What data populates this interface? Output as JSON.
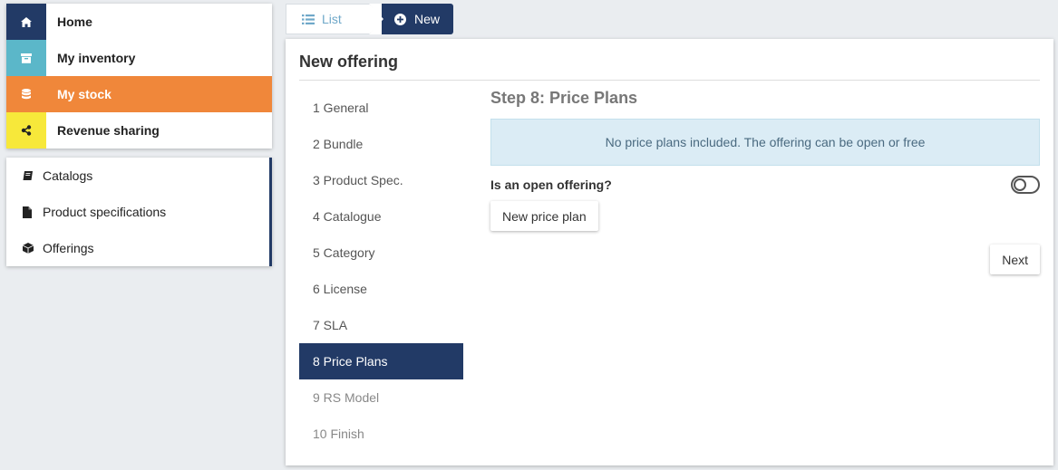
{
  "main_nav": [
    {
      "label": "Home",
      "icon": "home-icon",
      "color": "#223a66"
    },
    {
      "label": "My inventory",
      "icon": "archive-icon",
      "color": "#5bb7c9"
    },
    {
      "label": "My stock",
      "icon": "database-icon",
      "color": "#f0873a",
      "active": true
    },
    {
      "label": "Revenue sharing",
      "icon": "share-icon",
      "color": "#f7e83a"
    }
  ],
  "sub_nav": [
    {
      "label": "Catalogs",
      "icon": "book-icon"
    },
    {
      "label": "Product specifications",
      "icon": "file-icon"
    },
    {
      "label": "Offerings",
      "icon": "cube-icon",
      "active": true
    }
  ],
  "breadcrumb": {
    "list_label": "List",
    "new_label": "New"
  },
  "panel": {
    "title": "New offering",
    "steps": [
      {
        "label": "1 General"
      },
      {
        "label": "2 Bundle"
      },
      {
        "label": "3 Product Spec."
      },
      {
        "label": "4 Catalogue"
      },
      {
        "label": "5 Category"
      },
      {
        "label": "6 License"
      },
      {
        "label": "7 SLA"
      },
      {
        "label": "8 Price Plans",
        "active": true
      },
      {
        "label": "9 RS Model",
        "disabled": true
      },
      {
        "label": "10 Finish",
        "disabled": true
      }
    ],
    "step_title": "Step 8: Price Plans",
    "info_message": "No price plans included. The offering can be open or free",
    "open_offering_label": "Is an open offering?",
    "open_offering_value": false,
    "new_price_plan_label": "New price plan",
    "next_label": "Next"
  },
  "colors": {
    "primary": "#223a66",
    "accent_orange": "#f0873a",
    "accent_teal": "#5bb7c9",
    "accent_yellow": "#f7e83a",
    "info_bg": "#dbecf5"
  }
}
